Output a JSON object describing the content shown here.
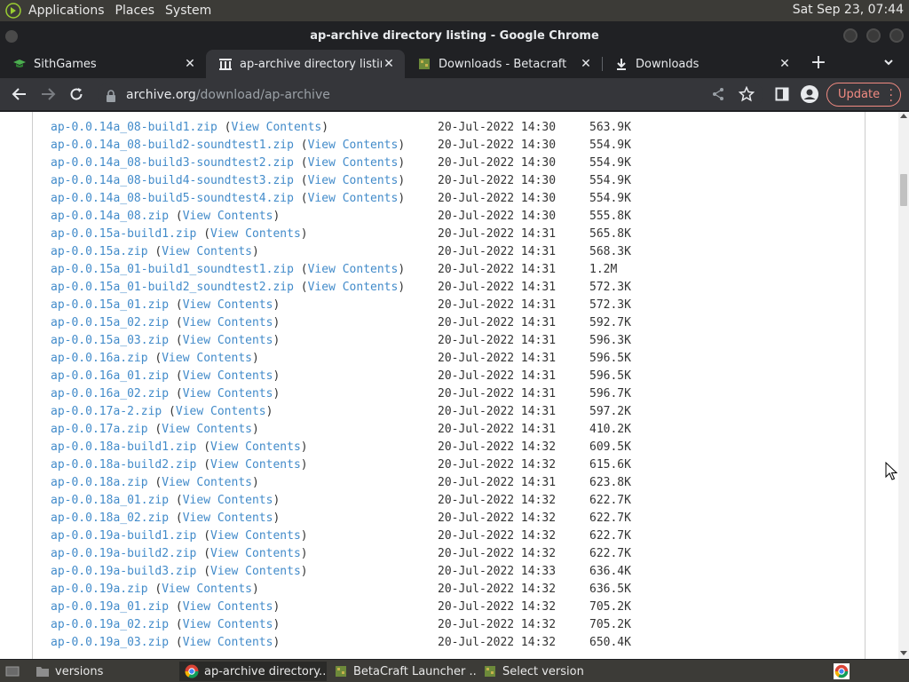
{
  "panel": {
    "menus": [
      "Applications",
      "Places",
      "System"
    ],
    "clock": "Sat Sep 23, 07:44"
  },
  "window": {
    "title": "ap-archive directory listing - Google Chrome"
  },
  "tabs": [
    {
      "title": "SithGames",
      "icon": "graduation-cap-icon"
    },
    {
      "title": "ap-archive directory listing",
      "icon": "archive-icon"
    },
    {
      "title": "Downloads - Betacraft",
      "icon": "betacraft-icon"
    },
    {
      "title": "Downloads",
      "icon": "download-icon"
    }
  ],
  "toolbar": {
    "url_host": "archive.org",
    "url_path": "/download/ap-archive",
    "update_label": "Update"
  },
  "listing": {
    "view_label": "View Contents",
    "rows": [
      {
        "name": "ap-0.0.14a_08-build1.zip",
        "date": "20-Jul-2022 14:30",
        "size": "563.9K"
      },
      {
        "name": "ap-0.0.14a_08-build2-soundtest1.zip",
        "date": "20-Jul-2022 14:30",
        "size": "554.9K"
      },
      {
        "name": "ap-0.0.14a_08-build3-soundtest2.zip",
        "date": "20-Jul-2022 14:30",
        "size": "554.9K"
      },
      {
        "name": "ap-0.0.14a_08-build4-soundtest3.zip",
        "date": "20-Jul-2022 14:30",
        "size": "554.9K"
      },
      {
        "name": "ap-0.0.14a_08-build5-soundtest4.zip",
        "date": "20-Jul-2022 14:30",
        "size": "554.9K"
      },
      {
        "name": "ap-0.0.14a_08.zip",
        "date": "20-Jul-2022 14:30",
        "size": "555.8K"
      },
      {
        "name": "ap-0.0.15a-build1.zip",
        "date": "20-Jul-2022 14:31",
        "size": "565.8K"
      },
      {
        "name": "ap-0.0.15a.zip",
        "date": "20-Jul-2022 14:31",
        "size": "568.3K"
      },
      {
        "name": "ap-0.0.15a_01-build1_soundtest1.zip",
        "date": "20-Jul-2022 14:31",
        "size": "1.2M"
      },
      {
        "name": "ap-0.0.15a_01-build2_soundtest2.zip",
        "date": "20-Jul-2022 14:31",
        "size": "572.3K"
      },
      {
        "name": "ap-0.0.15a_01.zip",
        "date": "20-Jul-2022 14:31",
        "size": "572.3K"
      },
      {
        "name": "ap-0.0.15a_02.zip",
        "date": "20-Jul-2022 14:31",
        "size": "592.7K"
      },
      {
        "name": "ap-0.0.15a_03.zip",
        "date": "20-Jul-2022 14:31",
        "size": "596.3K"
      },
      {
        "name": "ap-0.0.16a.zip",
        "date": "20-Jul-2022 14:31",
        "size": "596.5K"
      },
      {
        "name": "ap-0.0.16a_01.zip",
        "date": "20-Jul-2022 14:31",
        "size": "596.5K"
      },
      {
        "name": "ap-0.0.16a_02.zip",
        "date": "20-Jul-2022 14:31",
        "size": "596.7K"
      },
      {
        "name": "ap-0.0.17a-2.zip",
        "date": "20-Jul-2022 14:31",
        "size": "597.2K"
      },
      {
        "name": "ap-0.0.17a.zip",
        "date": "20-Jul-2022 14:31",
        "size": "410.2K"
      },
      {
        "name": "ap-0.0.18a-build1.zip",
        "date": "20-Jul-2022 14:32",
        "size": "609.5K"
      },
      {
        "name": "ap-0.0.18a-build2.zip",
        "date": "20-Jul-2022 14:32",
        "size": "615.6K"
      },
      {
        "name": "ap-0.0.18a.zip",
        "date": "20-Jul-2022 14:31",
        "size": "623.8K"
      },
      {
        "name": "ap-0.0.18a_01.zip",
        "date": "20-Jul-2022 14:32",
        "size": "622.7K"
      },
      {
        "name": "ap-0.0.18a_02.zip",
        "date": "20-Jul-2022 14:32",
        "size": "622.7K"
      },
      {
        "name": "ap-0.0.19a-build1.zip",
        "date": "20-Jul-2022 14:32",
        "size": "622.7K"
      },
      {
        "name": "ap-0.0.19a-build2.zip",
        "date": "20-Jul-2022 14:32",
        "size": "622.7K"
      },
      {
        "name": "ap-0.0.19a-build3.zip",
        "date": "20-Jul-2022 14:33",
        "size": "636.4K"
      },
      {
        "name": "ap-0.0.19a.zip",
        "date": "20-Jul-2022 14:32",
        "size": "636.5K"
      },
      {
        "name": "ap-0.0.19a_01.zip",
        "date": "20-Jul-2022 14:32",
        "size": "705.2K"
      },
      {
        "name": "ap-0.0.19a_02.zip",
        "date": "20-Jul-2022 14:32",
        "size": "705.2K"
      },
      {
        "name": "ap-0.0.19a_03.zip",
        "date": "20-Jul-2022 14:32",
        "size": "650.4K"
      }
    ]
  },
  "taskbar": [
    {
      "label": "versions",
      "icon": "folder-icon"
    },
    {
      "label": "ap-archive directory...",
      "icon": "chrome-icon"
    },
    {
      "label": "BetaCraft Launcher ...",
      "icon": "betacraft-icon"
    },
    {
      "label": "Select version",
      "icon": "betacraft-icon"
    }
  ]
}
